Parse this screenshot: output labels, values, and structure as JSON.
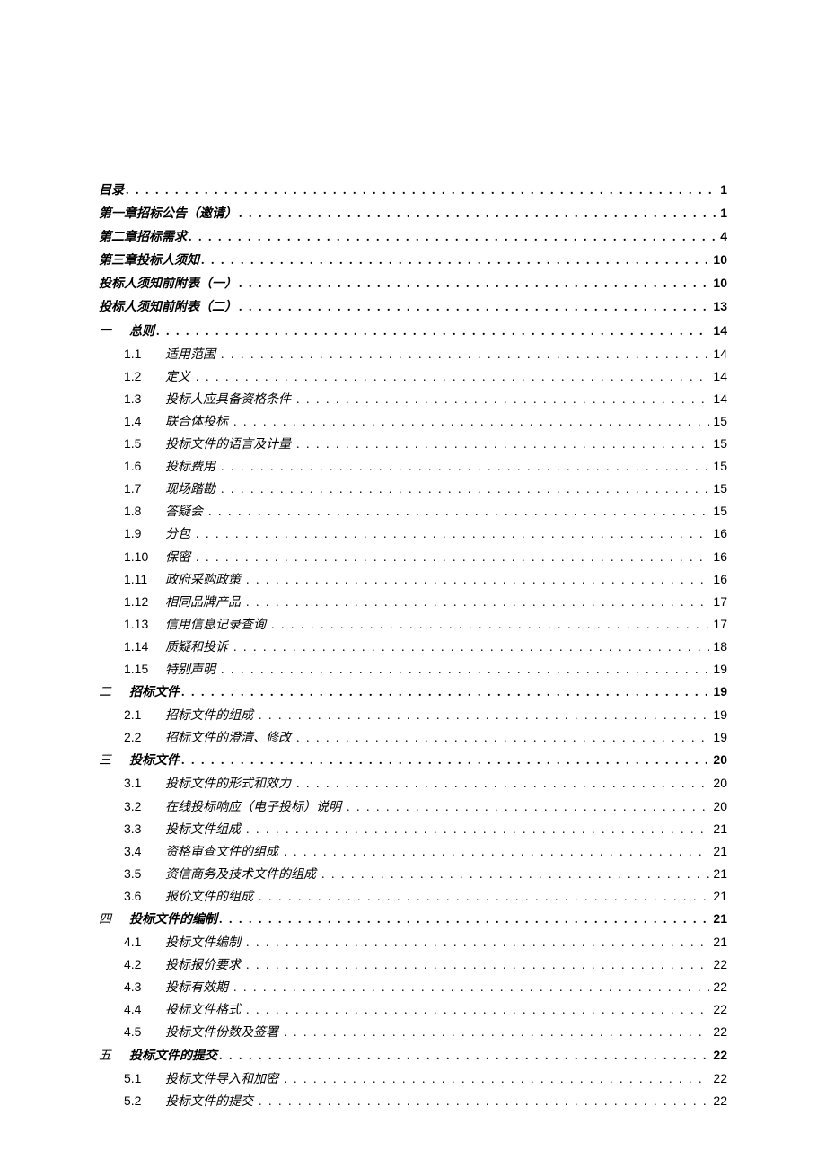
{
  "top": [
    {
      "label": "目录",
      "page": "1"
    },
    {
      "label": "第一章招标公告（邀请）",
      "page": "1"
    },
    {
      "label": "第二章招标需求",
      "page": "4"
    },
    {
      "label": "第三章投标人须知",
      "page": "10"
    },
    {
      "label": "投标人须知前附表（一）",
      "page": "10"
    },
    {
      "label": "投标人须知前附表（二）",
      "page": "13"
    }
  ],
  "sections": [
    {
      "roman": "一",
      "label": "总则",
      "page": "14",
      "items": [
        {
          "n": "1.1",
          "label": "适用范围",
          "page": "14"
        },
        {
          "n": "1.2",
          "label": "定义",
          "page": "14"
        },
        {
          "n": "1.3",
          "label": "投标人应具备资格条件",
          "page": "14"
        },
        {
          "n": "1.4",
          "label": "联合体投标",
          "page": "15"
        },
        {
          "n": "1.5",
          "label": "投标文件的语言及计量",
          "page": "15"
        },
        {
          "n": "1.6",
          "label": "投标费用",
          "page": "15"
        },
        {
          "n": "1.7",
          "label": "现场踏勘",
          "page": "15"
        },
        {
          "n": "1.8",
          "label": "答疑会",
          "page": "15"
        },
        {
          "n": "1.9",
          "label": "分包",
          "page": "16"
        },
        {
          "n": "1.10",
          "label": "保密",
          "page": "16"
        },
        {
          "n": "1.11",
          "label": "政府采购政策",
          "page": "16"
        },
        {
          "n": "1.12",
          "label": "相同品牌产品",
          "page": "17"
        },
        {
          "n": "1.13",
          "label": "信用信息记录查询",
          "page": "17"
        },
        {
          "n": "1.14",
          "label": "质疑和投诉",
          "page": "18"
        },
        {
          "n": "1.15",
          "label": "特别声明",
          "page": "19"
        }
      ]
    },
    {
      "roman": "二",
      "label": "招标文件",
      "page": "19",
      "items": [
        {
          "n": "2.1",
          "label": "招标文件的组成",
          "page": "19"
        },
        {
          "n": "2.2",
          "label": "招标文件的澄清、修改",
          "page": "19"
        }
      ]
    },
    {
      "roman": "三",
      "label": "投标文件",
      "page": "20",
      "items": [
        {
          "n": "3.1",
          "label": "投标文件的形式和效力",
          "page": "20"
        },
        {
          "n": "3.2",
          "label": "在线投标响应（电子投标）说明",
          "page": "20"
        },
        {
          "n": "3.3",
          "label": "投标文件组成",
          "page": "21"
        },
        {
          "n": "3.4",
          "label": "资格审查文件的组成",
          "page": "21"
        },
        {
          "n": "3.5",
          "label": "资信商务及技术文件的组成",
          "page": "21"
        },
        {
          "n": "3.6",
          "label": "报价文件的组成",
          "page": "21"
        }
      ]
    },
    {
      "roman": "四",
      "label": "投标文件的编制",
      "page": "21",
      "items": [
        {
          "n": "4.1",
          "label": "投标文件编制",
          "page": "21"
        },
        {
          "n": "4.2",
          "label": "投标报价要求",
          "page": "22"
        },
        {
          "n": "4.3",
          "label": "投标有效期",
          "page": "22"
        },
        {
          "n": "4.4",
          "label": "投标文件格式",
          "page": "22"
        },
        {
          "n": "4.5",
          "label": "投标文件份数及签署",
          "page": "22"
        }
      ]
    },
    {
      "roman": "五",
      "label": "投标文件的提交",
      "page": "22",
      "items": [
        {
          "n": "5.1",
          "label": "投标文件导入和加密",
          "page": "22"
        },
        {
          "n": "5.2",
          "label": "投标文件的提交",
          "page": "22"
        }
      ]
    }
  ]
}
